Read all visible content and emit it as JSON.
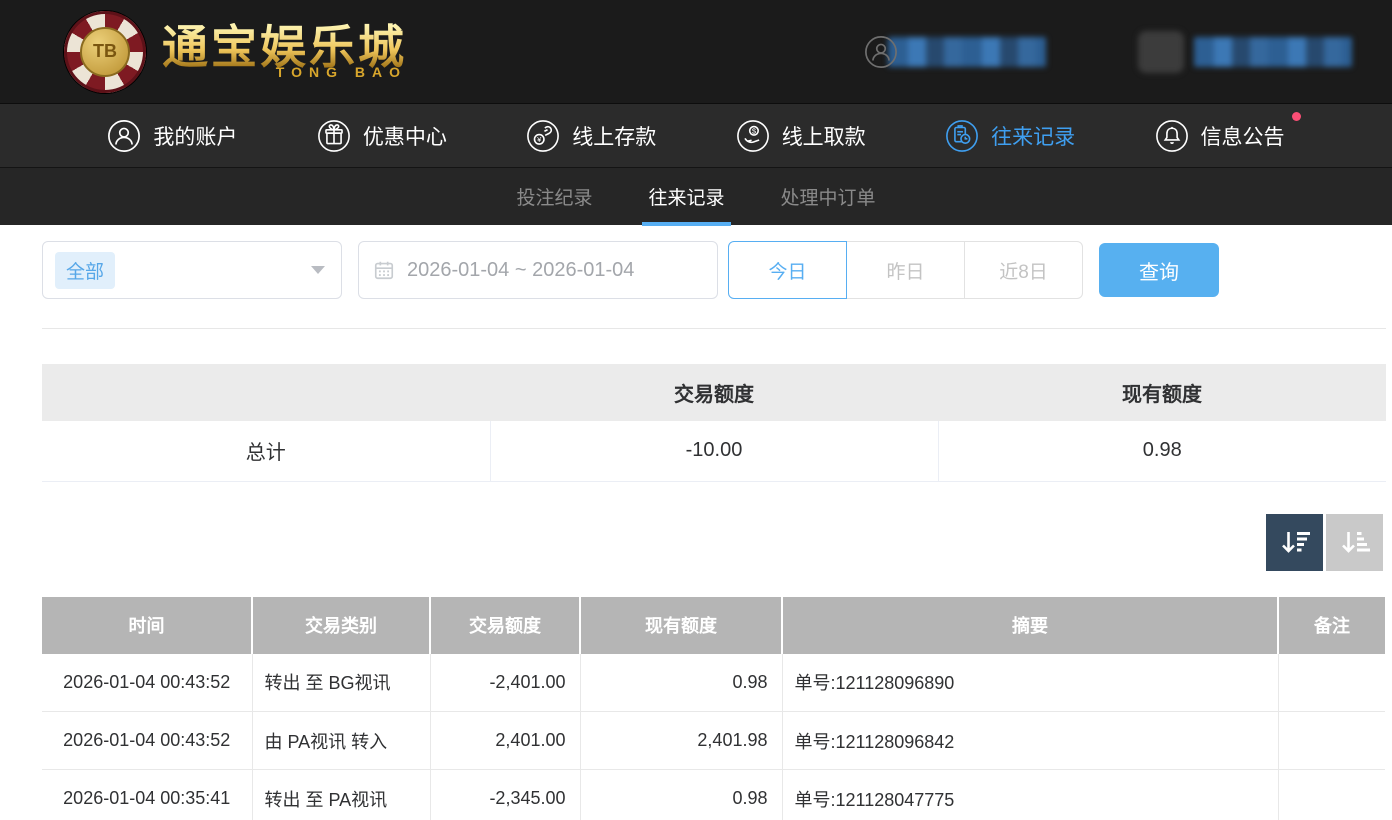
{
  "brand": {
    "chip_initials": "TB",
    "name": "通宝娱乐城",
    "subtitle": "TONG BAO"
  },
  "nav": {
    "items": [
      {
        "label": "我的账户",
        "icon": "user-icon",
        "active": false
      },
      {
        "label": "优惠中心",
        "icon": "gift-icon",
        "active": false
      },
      {
        "label": "线上存款",
        "icon": "deposit-hand-coin-icon",
        "active": false
      },
      {
        "label": "线上取款",
        "icon": "withdraw-hand-coin-icon",
        "active": false
      },
      {
        "label": "往来记录",
        "icon": "transfer-records-icon",
        "active": true
      },
      {
        "label": "信息公告",
        "icon": "bell-icon",
        "active": false,
        "has_notification_dot": true
      }
    ]
  },
  "tabs": [
    {
      "label": "投注纪录",
      "active": false
    },
    {
      "label": "往来记录",
      "active": true
    },
    {
      "label": "处理中订单",
      "active": false
    }
  ],
  "filters": {
    "type_select": {
      "selected_tag": "全部"
    },
    "date_range": "2026-01-04 ~ 2026-01-04",
    "quick_buttons": [
      {
        "label": "今日",
        "active": true
      },
      {
        "label": "昨日",
        "active": false
      },
      {
        "label": "近8日",
        "active": false
      }
    ],
    "search_label": "查询"
  },
  "summary_table": {
    "col_transaction": "交易额度",
    "col_balance": "现有额度",
    "total_label": "总计",
    "total_transaction": "-10.00",
    "total_balance": "0.98"
  },
  "records_table": {
    "headers": {
      "time": "时间",
      "type": "交易类别",
      "amount": "交易额度",
      "balance": "现有额度",
      "summary": "摘要",
      "note": "备注"
    },
    "rows": [
      {
        "time": "2026-01-04 00:43:52",
        "type": "转出 至 BG视讯",
        "amount": "-2,401.00",
        "balance": "0.98",
        "summary": "单号:121128096890",
        "note": ""
      },
      {
        "time": "2026-01-04 00:43:52",
        "type": "由 PA视讯 转入",
        "amount": "2,401.00",
        "balance": "2,401.98",
        "summary": "单号:121128096842",
        "note": ""
      },
      {
        "time": "2026-01-04 00:35:41",
        "type": "转出 至 PA视讯",
        "amount": "-2,345.00",
        "balance": "0.98",
        "summary": "单号:121128047775",
        "note": ""
      }
    ]
  },
  "colors": {
    "accent_blue": "#57aef2",
    "nav_active_blue": "#3f9ff0",
    "notification_dot": "#fb4e75",
    "search_button_bg": "#57b0f0",
    "sort_active_bg": "#34495e",
    "sort_inactive_bg": "#c9c9c9",
    "records_header_bg": "#b5b5b5",
    "summary_header_bg": "#ebebeb",
    "header_bg": "#1b1b1b",
    "gold_brand": "#e3b74a"
  }
}
